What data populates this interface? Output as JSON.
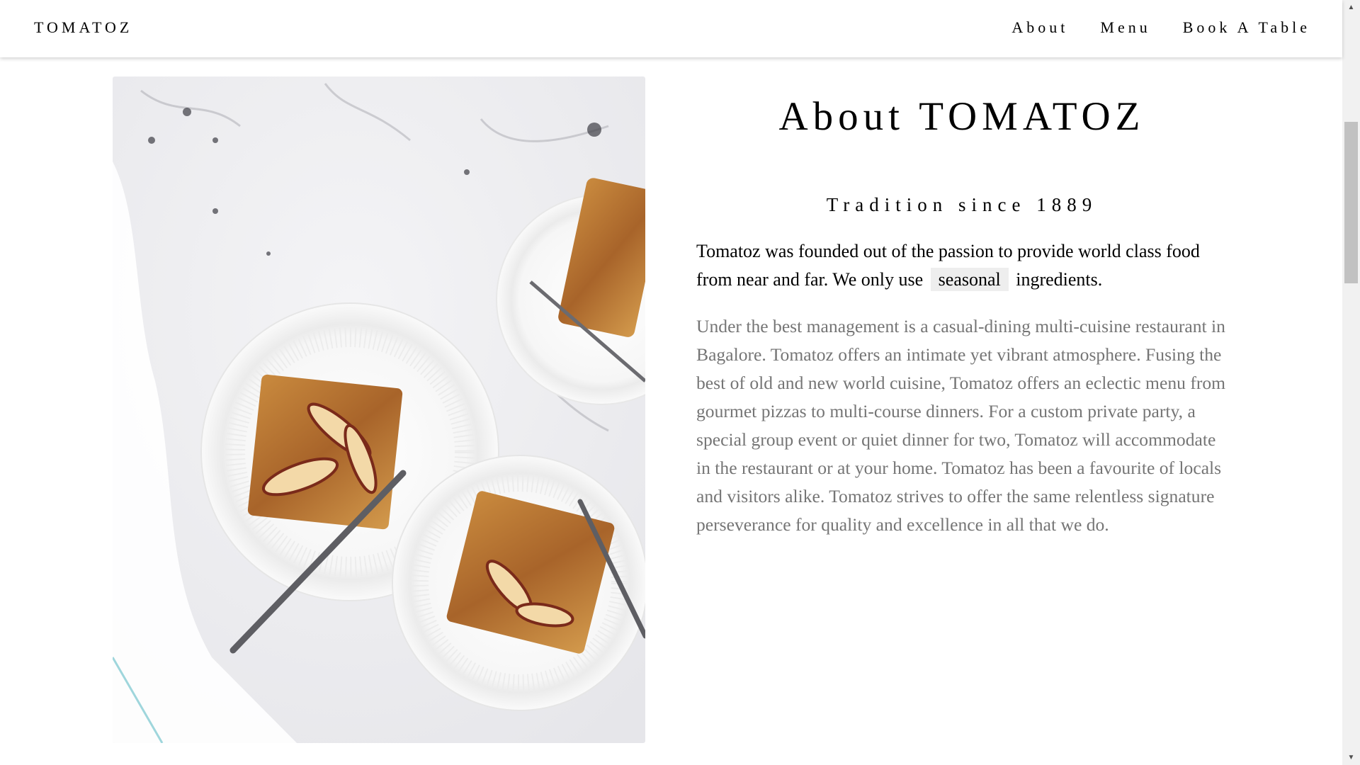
{
  "navbar": {
    "brand": "TOMATOZ",
    "links": [
      "About",
      "Menu",
      "Book A Table"
    ]
  },
  "about": {
    "heading": "About TOMATOZ",
    "subheading": "Tradition since 1889",
    "lead_before": "Tomatoz was founded out of the passion to provide world class food from near and far. We only use",
    "lead_tag": "seasonal",
    "lead_after": "ingredients.",
    "description": "Under the best management is a casual-dining multi-cuisine restaurant in Bagalore. Tomatoz offers an intimate yet vibrant atmosphere. Fusing the best of old and new world cuisine, Tomatoz offers an eclectic menu from gourmet pizzas to multi-course dinners. For a custom private party, a special group event or quiet dinner for two, Tomatoz will accommodate in the restaurant or at your home. Tomatoz has been a favourite of locals and visitors alike. Tomatoz strives to offer the same relentless signature perseverance for quality and excellence in all that we do."
  },
  "colors": {
    "body_text_muted": "#757575",
    "tag_background": "#eeeeee"
  },
  "icons": {
    "scroll_up": "▲",
    "scroll_down": "▼"
  }
}
